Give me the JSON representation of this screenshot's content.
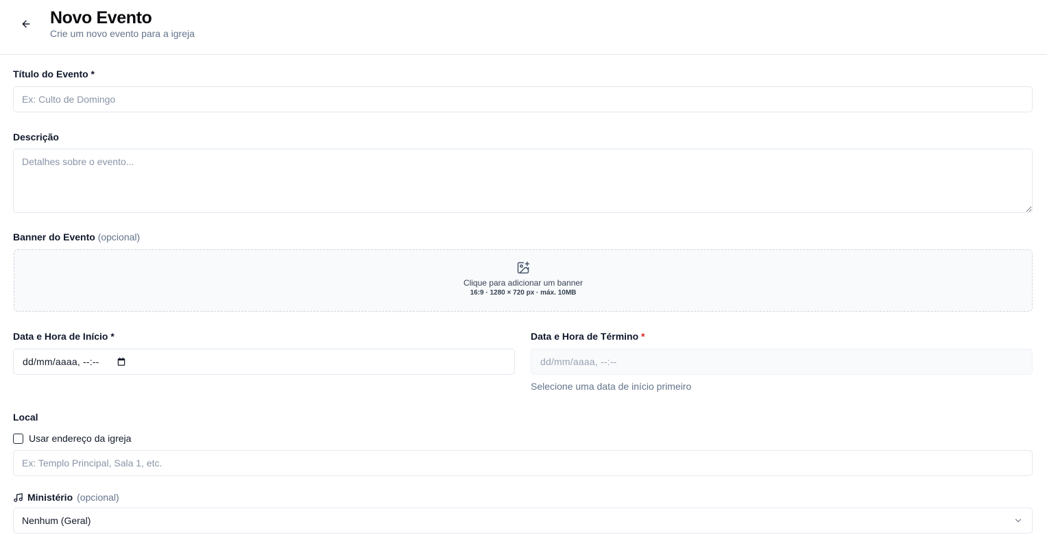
{
  "header": {
    "title": "Novo Evento",
    "subtitle": "Crie um novo evento para a igreja"
  },
  "form": {
    "title_field": {
      "label": "Título do Evento *",
      "placeholder": "Ex: Culto de Domingo",
      "value": ""
    },
    "description_field": {
      "label": "Descrição",
      "placeholder": "Detalhes sobre o evento...",
      "value": ""
    },
    "banner_field": {
      "label": "Banner do Evento",
      "optional": "(opcional)",
      "upload_text": "Clique para adicionar um banner",
      "upload_hint": "16:9 · 1280 × 720 px · máx. 10MB"
    },
    "start_datetime": {
      "label": "Data e Hora de Início *",
      "placeholder": "dd/mm/aaaa, --:--"
    },
    "end_datetime": {
      "label": "Data e Hora de Término",
      "required_mark": "*",
      "placeholder": "dd/mm/aaaa, --:--",
      "helper": "Selecione uma data de início primeiro",
      "disabled": true
    },
    "location": {
      "label": "Local",
      "checkbox_label": "Usar endereço da igreja",
      "checkbox_checked": false,
      "placeholder": "Ex: Templo Principal, Sala 1, etc."
    },
    "ministry": {
      "label": "Ministério",
      "optional": "(opcional)",
      "selected": "Nenhum (Geral)"
    }
  }
}
